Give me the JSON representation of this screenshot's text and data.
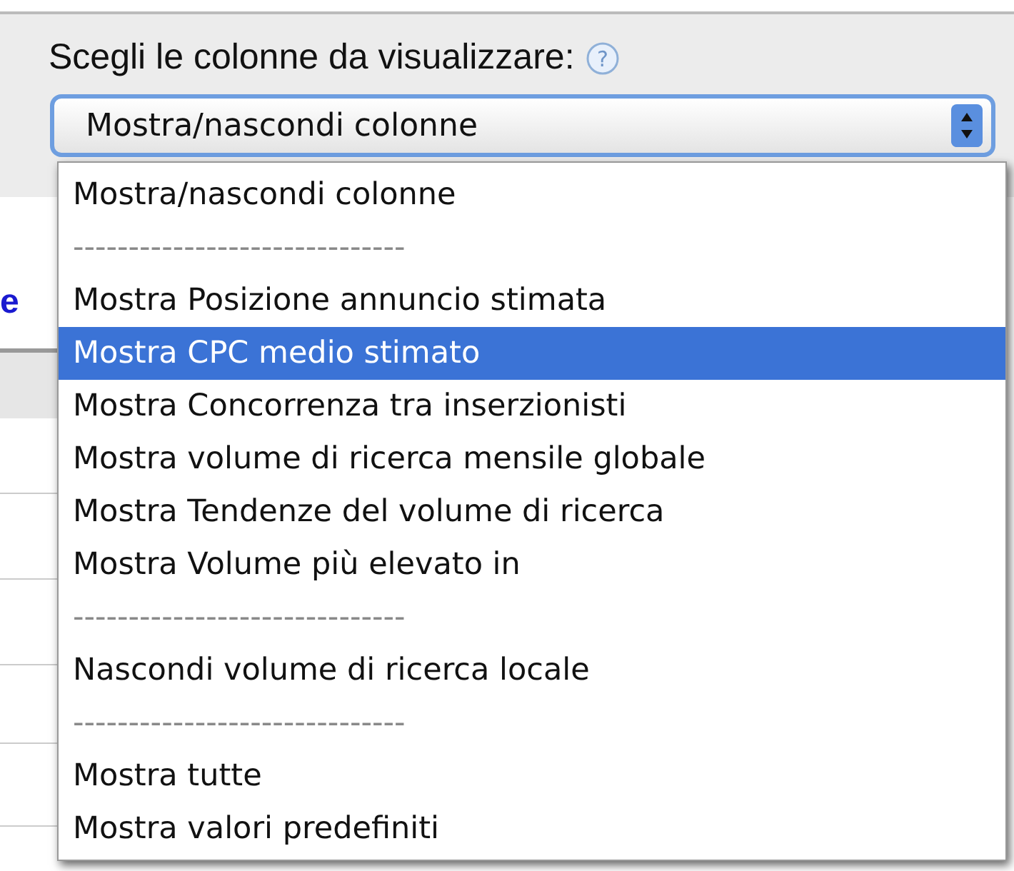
{
  "label": "Scegli le colonne da visualizzare:",
  "help_icon": "?",
  "select": {
    "value": "Mostra/nascondi colonne"
  },
  "background_link": "e",
  "menu": [
    {
      "kind": "option",
      "label": "Mostra/nascondi colonne",
      "selected": false
    },
    {
      "kind": "separator",
      "label": "------------------------------"
    },
    {
      "kind": "option",
      "label": "Mostra Posizione annuncio stimata",
      "selected": false
    },
    {
      "kind": "option",
      "label": "Mostra CPC medio stimato",
      "selected": true
    },
    {
      "kind": "option",
      "label": "Mostra Concorrenza tra inserzionisti",
      "selected": false
    },
    {
      "kind": "option",
      "label": "Mostra volume di ricerca mensile globale",
      "selected": false
    },
    {
      "kind": "option",
      "label": "Mostra Tendenze del volume di ricerca",
      "selected": false
    },
    {
      "kind": "option",
      "label": "Mostra Volume più elevato in",
      "selected": false
    },
    {
      "kind": "separator",
      "label": "------------------------------"
    },
    {
      "kind": "option",
      "label": "Nascondi volume di ricerca locale",
      "selected": false
    },
    {
      "kind": "separator",
      "label": "------------------------------"
    },
    {
      "kind": "option",
      "label": "Mostra tutte",
      "selected": false
    },
    {
      "kind": "option",
      "label": "Mostra valori predefiniti",
      "selected": false
    }
  ]
}
